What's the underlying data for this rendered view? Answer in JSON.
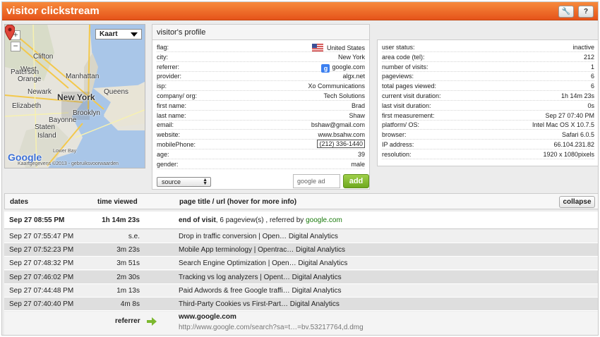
{
  "header": {
    "title": "visitor clickstream",
    "wrench_label": "🔧",
    "help_label": "?"
  },
  "map": {
    "map_type": "Kaart",
    "zoom_in": "+",
    "zoom_out": "−",
    "labels": [
      "Clifton",
      "Paterson",
      "Manhattan",
      "West",
      "Orange",
      "Newark",
      "New York",
      "Queens",
      "Elizabeth",
      "Bayonne",
      "Brooklyn",
      "Staten",
      "Island",
      "Lower Bay"
    ],
    "google_logo": "Google",
    "attribution": "Kaartgegevens ©2013 - gebruiksvoorwaarden"
  },
  "profile": {
    "title": "visitor's profile",
    "left": [
      {
        "key": "flag:",
        "value": "United States"
      },
      {
        "key": "city:",
        "value": "New York"
      },
      {
        "key": "referrer:",
        "value": "google.com"
      },
      {
        "key": "provider:",
        "value": "algx.net"
      },
      {
        "key": "isp:",
        "value": "Xo Communications"
      },
      {
        "key": "company/ org:",
        "value": "Tech Solutions"
      },
      {
        "key": "first name:",
        "value": "Brad"
      },
      {
        "key": "last name:",
        "value": "Shaw"
      },
      {
        "key": "email:",
        "value": "bshaw@gmail.com"
      },
      {
        "key": "website:",
        "value": "www.bsahw.com"
      },
      {
        "key": "mobilePhone:",
        "value": "(212) 336-1440"
      },
      {
        "key": "age:",
        "value": "39"
      },
      {
        "key": "gender:",
        "value": "male"
      }
    ],
    "right": [
      {
        "key": "user status:",
        "value": "inactive"
      },
      {
        "key": "area code (tel):",
        "value": "212"
      },
      {
        "key": "number of visits:",
        "value": "1"
      },
      {
        "key": "pageviews:",
        "value": "6"
      },
      {
        "key": "total pages viewed:",
        "value": "6"
      },
      {
        "key": "current visit duration:",
        "value": "1h 14m 23s"
      },
      {
        "key": "last visit duration:",
        "value": "0s"
      },
      {
        "key": "first measurement:",
        "value": "Sep 27 07:40 PM"
      },
      {
        "key": "platform/ OS:",
        "value": "Intel Mac OS X 10.7.5"
      },
      {
        "key": "browser:",
        "value": "Safari 6.0.5"
      },
      {
        "key": "IP address:",
        "value": "66.104.231.82"
      },
      {
        "key": "resolution:",
        "value": "1920 x 1080pixels"
      }
    ],
    "source_select": "source",
    "tag_input": "google ad",
    "add_label": "add"
  },
  "table": {
    "headers": {
      "dates": "dates",
      "time": "time viewed",
      "page": "page title / url (hover for more info)"
    },
    "collapse_label": "collapse",
    "end": {
      "date": "Sep 27 08:55 PM",
      "time": "1h 14m 23s",
      "label": "end of visit",
      "summary": ", 6 pageview(s) , referred by ",
      "referrer": "google.com"
    },
    "rows": [
      {
        "date": "Sep 27 07:55:47 PM",
        "time": "s.e.",
        "page": "Drop in traffic conversion | Open… Digital Analytics"
      },
      {
        "date": "Sep 27 07:52:23 PM",
        "time": "3m 23s",
        "page": "Mobile App terminology | Opentrac… Digital Analytics"
      },
      {
        "date": "Sep 27 07:48:32 PM",
        "time": "3m 51s",
        "page": "Search Engine Optimization | Open… Digital Analytics"
      },
      {
        "date": "Sep 27 07:46:02 PM",
        "time": "2m 30s",
        "page": "Tracking vs log analyzers | Opent… Digital Analytics"
      },
      {
        "date": "Sep 27 07:44:48 PM",
        "time": "1m 13s",
        "page": "Paid Adwords & free Google traffi… Digital Analytics"
      },
      {
        "date": "Sep 27 07:40:40 PM",
        "time": "4m 8s",
        "page": "Third-Party Cookies vs First-Part… Digital Analytics"
      }
    ],
    "referrer": {
      "label": "referrer",
      "site": "www.google.com",
      "url": "http://www.google.com/search?sa=t…=bv.53217764,d.dmg"
    }
  }
}
